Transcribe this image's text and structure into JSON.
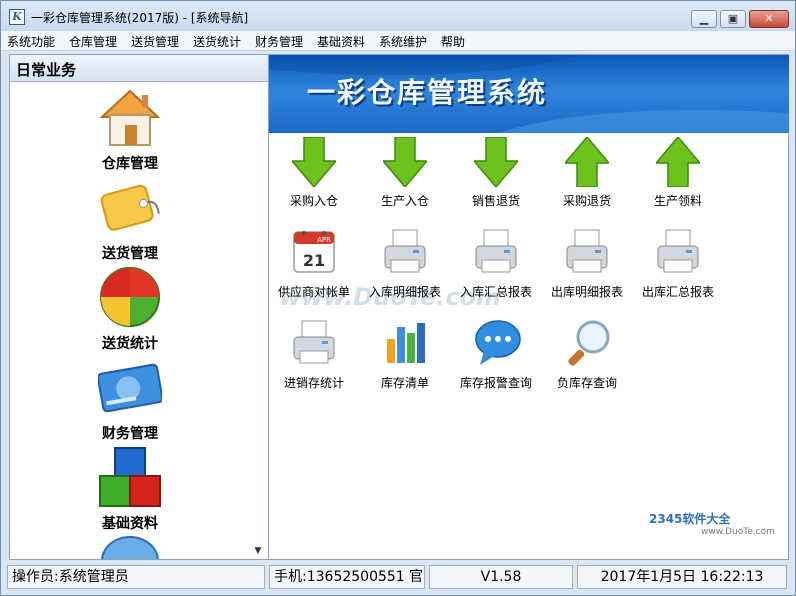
{
  "window": {
    "title": "一彩仓库管理系统(2017版) - [系统导航]",
    "icon": "app-logo-icon",
    "controls": [
      "minimize-icon",
      "maximize-icon",
      "close-icon"
    ]
  },
  "menu": [
    "系统功能",
    "仓库管理",
    "送货管理",
    "送货统计",
    "财务管理",
    "基础资料",
    "系统维护",
    "帮助"
  ],
  "sidebar": {
    "header": "日常业务",
    "items": [
      {
        "label": "仓库管理",
        "icon": "house-icon"
      },
      {
        "label": "送货管理",
        "icon": "tag-icon"
      },
      {
        "label": "送货统计",
        "icon": "pie-chart-icon"
      },
      {
        "label": "财务管理",
        "icon": "card-icon"
      },
      {
        "label": "基础资料",
        "icon": "blocks-icon"
      }
    ]
  },
  "banner": {
    "title": "一彩仓库管理系统"
  },
  "tiles": [
    {
      "label": "采购入仓",
      "icon": "down-arrow-icon"
    },
    {
      "label": "生产入仓",
      "icon": "down-arrow-icon"
    },
    {
      "label": "销售退货",
      "icon": "down-arrow-icon"
    },
    {
      "label": "采购退货",
      "icon": "up-arrow-icon"
    },
    {
      "label": "生产领料",
      "icon": "up-arrow-icon"
    },
    {
      "label": "供应商对帐单",
      "icon": "calendar-icon",
      "calendar_month": "APR",
      "calendar_day": "21"
    },
    {
      "label": "入库明细报表",
      "icon": "printer-icon"
    },
    {
      "label": "入库汇总报表",
      "icon": "printer-icon"
    },
    {
      "label": "出库明细报表",
      "icon": "printer-icon"
    },
    {
      "label": "出库汇总报表",
      "icon": "printer-icon"
    },
    {
      "label": "进销存统计",
      "icon": "printer-icon"
    },
    {
      "label": "库存清单",
      "icon": "bar-chart-icon"
    },
    {
      "label": "库存报警查询",
      "icon": "speech-bubble-icon"
    },
    {
      "label": "负库存查询",
      "icon": "magnifier-icon"
    }
  ],
  "watermark": "www.DuoTe.com",
  "corner_logo": {
    "text": "2345软件大全",
    "url": "www.DuoTe.com"
  },
  "status": {
    "operator": "操作员:系统管理员",
    "phone": "手机:13652500551 官",
    "version": "V1.58",
    "datetime": "2017年1月5日  16:22:13"
  },
  "colors": {
    "banner": "#1c6bc7",
    "arrow_green": "#6ec21e",
    "title_bar": "#c9daee"
  }
}
